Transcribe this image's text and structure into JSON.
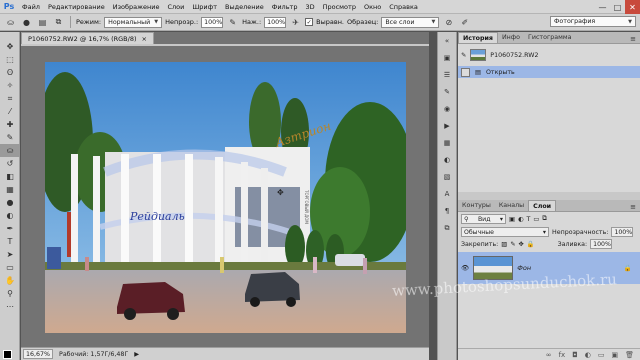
{
  "app": {
    "logo": "Ps"
  },
  "menu": [
    "Файл",
    "Редактирование",
    "Изображение",
    "Слои",
    "Шрифт",
    "Выделение",
    "Фильтр",
    "3D",
    "Просмотр",
    "Окно",
    "Справка"
  ],
  "window_controls": [
    "—",
    "□",
    "✕"
  ],
  "options_bar": {
    "mode_label": "Режим:",
    "mode_value": "Нормальный",
    "opacity_label": "Непрозр.:",
    "opacity_value": "100%",
    "pressure_label": "Наж.:",
    "pressure_value": "100%",
    "aligned_label": "Выравн.",
    "sample_label": "Образец:",
    "sample_value": "Все слои",
    "workspace_value": "Фотография"
  },
  "document": {
    "tab_title": "P1060752.RW2 @ 16,7% (RGB/8)",
    "tab_close": "×",
    "sign_text": "Азтрион",
    "sign_subtext": "ТОРГОВЫЙ ДОМ",
    "tube_text": "Рейдиаль"
  },
  "status": {
    "zoom": "16,67%",
    "doc_info": "Рабочий: 1,57Г/6,48Г"
  },
  "history_panel": {
    "tabs": [
      "История",
      "Инфо",
      "Гистограмма"
    ],
    "snapshot_name": "P1060752.RW2",
    "steps": [
      "Открыть"
    ]
  },
  "layers_panel": {
    "tabs": [
      "Контуры",
      "Каналы",
      "Слои"
    ],
    "kind_label": "Вид",
    "blend_mode": "Обычные",
    "opacity_label": "Непрозрачность:",
    "opacity_value": "100%",
    "lock_label": "Закрепить:",
    "fill_label": "Заливка:",
    "fill_value": "100%",
    "layers": [
      {
        "name": "Фон",
        "locked": true,
        "visible": true
      }
    ]
  },
  "watermark": "www.photoshopsunduchok.ru",
  "colors": {
    "foreground": "#000000",
    "background": "#ffffff",
    "selection": "#9cb7e6"
  }
}
